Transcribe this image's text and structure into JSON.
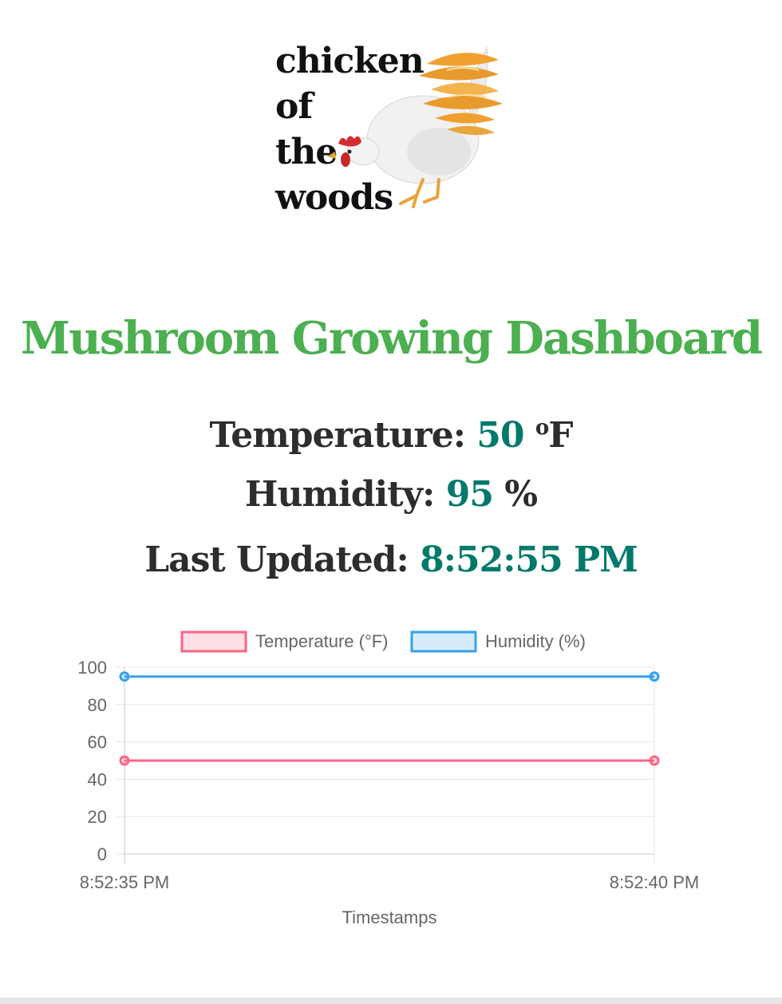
{
  "logo": {
    "lines": [
      "chicken",
      "of",
      "the",
      "woods"
    ]
  },
  "page": {
    "title": "Mushroom Growing Dashboard"
  },
  "stats": {
    "temperature_label": "Temperature:",
    "temperature_value": "50",
    "temperature_unit_sup": "o",
    "temperature_unit": "F",
    "humidity_label": "Humidity:",
    "humidity_value": "95",
    "humidity_unit": "%",
    "updated_label": "Last Updated:",
    "updated_value": "8:52:55 PM"
  },
  "colors": {
    "title": "#4caf50",
    "value": "#00796b",
    "temperature": "#ff6384",
    "humidity": "#36a2eb"
  },
  "chart_data": {
    "type": "line",
    "x": [
      "8:52:35 PM",
      "8:52:40 PM"
    ],
    "xlabel": "Timestamps",
    "ylabel": "",
    "ylim": [
      0,
      100
    ],
    "yticks": [
      0,
      20,
      40,
      60,
      80,
      100
    ],
    "grid": true,
    "legend": "top",
    "series": [
      {
        "name": "Temperature (°F)",
        "values": [
          50,
          50
        ],
        "color": "#ff6384"
      },
      {
        "name": "Humidity (%)",
        "values": [
          95,
          95
        ],
        "color": "#36a2eb"
      }
    ]
  }
}
